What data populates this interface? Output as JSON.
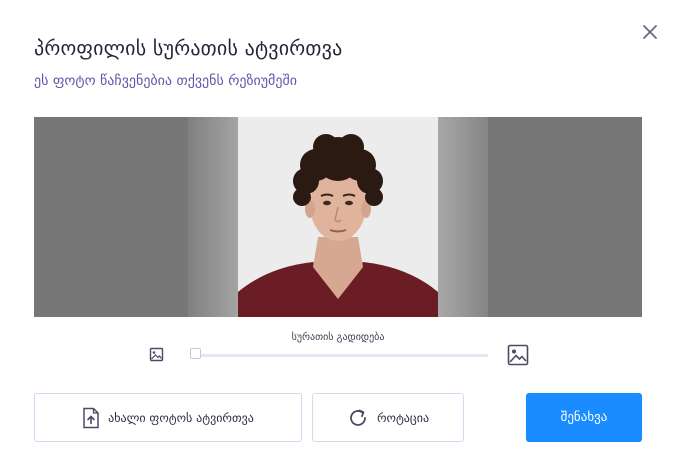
{
  "dialog": {
    "title": "პროფილის სურათის ატვირთვა",
    "subtitle": "ეს ფოტო წაჩვენებია თქვენს რეზიუმეში",
    "close_icon": "close-icon"
  },
  "crop": {
    "image_icon": "portrait-photo"
  },
  "zoom": {
    "label": "სურათის გადიდება",
    "value": 0.0,
    "icon_small": "image-small-icon",
    "icon_large": "image-large-icon"
  },
  "actions": {
    "upload_label": "ახალი ფოტოს ატვირთვა",
    "upload_icon": "upload-file-icon",
    "rotate_label": "როტაცია",
    "rotate_icon": "rotate-icon",
    "save_label": "შენახვა"
  },
  "colors": {
    "accent": "#1a8cff",
    "subtitle": "#5c58a8",
    "crop_background": "#777777"
  }
}
